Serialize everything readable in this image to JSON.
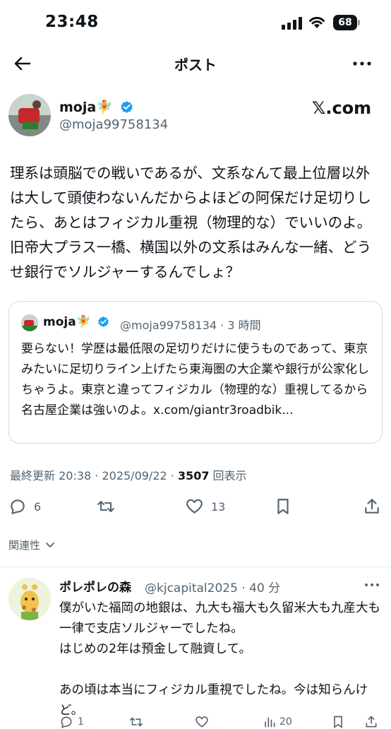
{
  "status_bar": {
    "time": "23:48",
    "battery": "68"
  },
  "header": {
    "title": "ポスト"
  },
  "author": {
    "name": "moja🧚",
    "handle": "@moja99758134",
    "source_label": "𝕏.com",
    "verified_color": "#1d9bf0"
  },
  "tweet": {
    "text": "理系は頭脳での戦いであるが、文系なんて最上位層以外は大して頭使わないんだからよほどの阿保だけ足切りしたら、あとはフィジカル重視（物理的な）でいいのよ。旧帝大プラス一橋、横国以外の文系はみんな一緒、どうせ銀行でソルジャーするんでしょ？"
  },
  "quote": {
    "name": "moja🧚",
    "handle_time": "@moja99758134 · 3 時間",
    "text": "要らない！学歴は最低限の足切りだけに使うものであって、東京みたいに足切りライン上げたら東海圏の大企業や銀行が公家化しちゃうよ。東京と違ってフィジカル（物理的な）重視してるから名古屋企業は強いのよ。x.com/giantr3roadbik..."
  },
  "meta": {
    "updated": "最終更新 20:38 · 2025/09/22 · ",
    "views_count": "3507",
    "views_label": " 回表示"
  },
  "actions": {
    "reply_count": "6",
    "retweet_count": "",
    "like_count": "13"
  },
  "relevance": {
    "label": "関連性"
  },
  "reply": {
    "name": "ポレポレの森",
    "handle_time": "@kjcapital2025 · 40 分",
    "text": "僕がいた福岡の地銀は、九大も福大も久留米大も九産大も一律で支店ソルジャーでしたね。\nはじめの2年は預金して融資して。\n\nあの頃は本当にフィジカル重視でしたね。今は知らんけど。",
    "reply_count": "1",
    "view_count": "20"
  }
}
